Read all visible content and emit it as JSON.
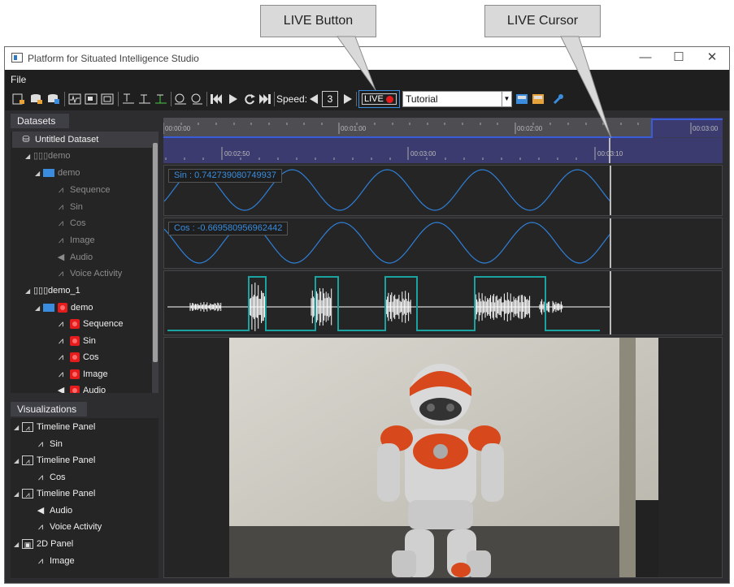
{
  "annotations": {
    "live_button": "LIVE Button",
    "live_cursor": "LIVE Cursor"
  },
  "window": {
    "title": "Platform for Situated Intelligence Studio",
    "minimize": "—",
    "maximize": "☐",
    "close": "✕"
  },
  "menu": {
    "file": "File"
  },
  "toolbar": {
    "speed_label": "Speed:",
    "speed_value": "3",
    "live_label": "LIVE",
    "layout_value": "Tutorial",
    "colors": {
      "live_border": "#3a8dde",
      "live_dot": "#e41c1c",
      "accent": "#3a8dde"
    }
  },
  "datasets": {
    "header": "Datasets",
    "items": [
      {
        "label": "Untitled Dataset",
        "icon": "database-icon"
      },
      {
        "label": "demo",
        "icon": "session-icon"
      },
      {
        "label": "demo",
        "icon": "partition-icon"
      },
      {
        "label": "Sequence",
        "icon": "stream-icon"
      },
      {
        "label": "Sin",
        "icon": "stream-icon"
      },
      {
        "label": "Cos",
        "icon": "stream-icon"
      },
      {
        "label": "Image",
        "icon": "stream-icon"
      },
      {
        "label": "Audio",
        "icon": "audio-icon"
      },
      {
        "label": "Voice Activity",
        "icon": "stream-icon"
      },
      {
        "label": "demo_1",
        "icon": "session-icon"
      },
      {
        "label": "demo",
        "icon": "partition-icon"
      },
      {
        "label": "Sequence",
        "icon": "stream-icon"
      },
      {
        "label": "Sin",
        "icon": "stream-icon"
      },
      {
        "label": "Cos",
        "icon": "stream-icon"
      },
      {
        "label": "Image",
        "icon": "stream-icon"
      },
      {
        "label": "Audio",
        "icon": "audio-icon"
      }
    ]
  },
  "visualizations": {
    "header": "Visualizations",
    "items": [
      {
        "label": "Timeline Panel",
        "icon": "timeline-panel-icon"
      },
      {
        "label": "Sin",
        "icon": "stream-icon"
      },
      {
        "label": "Timeline Panel",
        "icon": "timeline-panel-icon"
      },
      {
        "label": "Cos",
        "icon": "stream-icon"
      },
      {
        "label": "Timeline Panel",
        "icon": "timeline-panel-icon"
      },
      {
        "label": "Audio",
        "icon": "audio-icon"
      },
      {
        "label": "Voice Activity",
        "icon": "stream-icon"
      },
      {
        "label": "2D Panel",
        "icon": "2d-panel-icon"
      },
      {
        "label": "Image",
        "icon": "stream-icon"
      }
    ]
  },
  "timeline": {
    "top_ticks": [
      "00:00:00",
      "00:01:00",
      "00:02:00",
      "00:03:00"
    ],
    "bottom_ticks": [
      "00:02:50",
      "00:03:00",
      "00:03:10"
    ]
  },
  "panels": {
    "sin": {
      "label": "Sin  :  0.742739080749937"
    },
    "cos": {
      "label": "Cos  :  -0.669580956962442"
    }
  }
}
